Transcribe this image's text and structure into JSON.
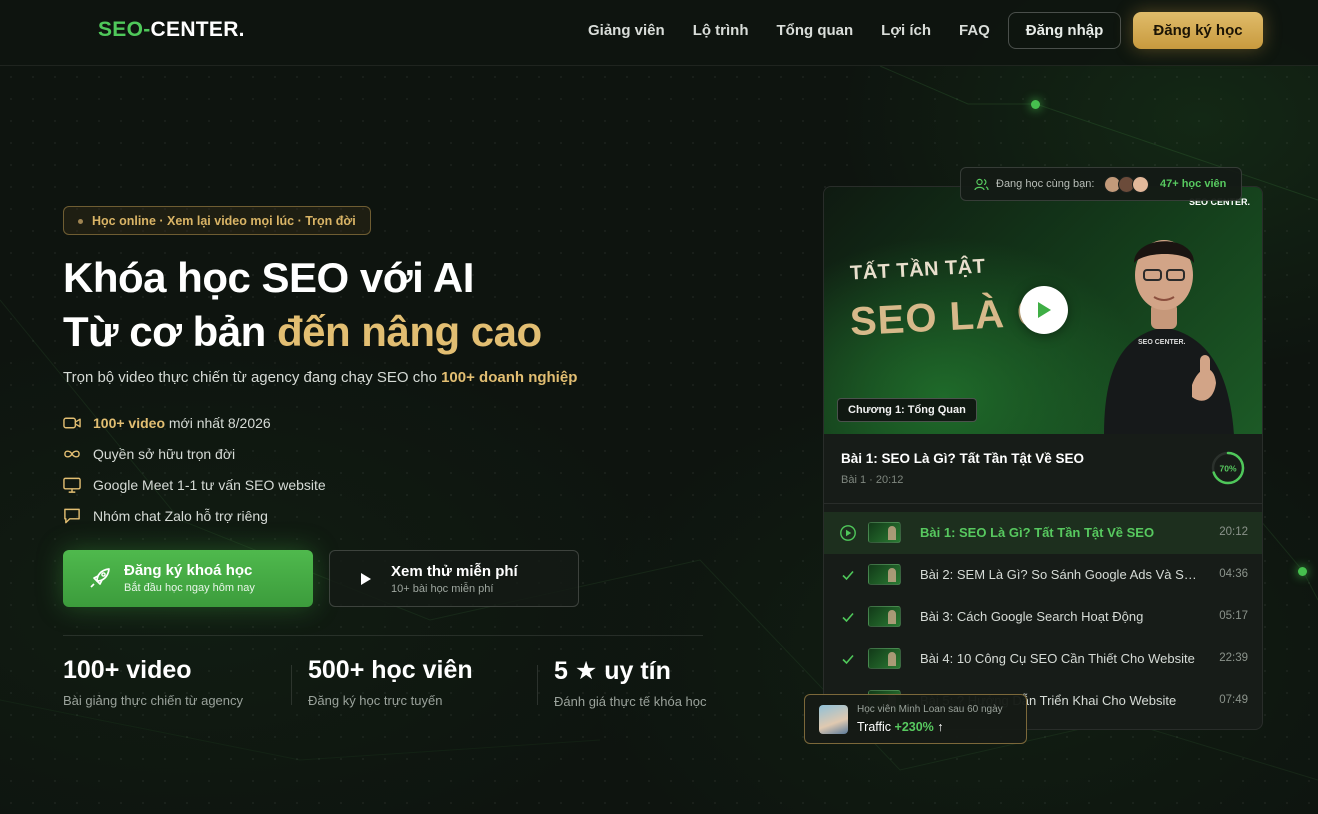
{
  "header": {
    "logo_part1": "SEO",
    "logo_part2": "CENTER.",
    "nav": [
      "Giảng viên",
      "Lộ trình",
      "Tổng quan",
      "Lợi ích",
      "FAQ"
    ],
    "login_label": "Đăng nhập",
    "register_label": "Đăng ký học"
  },
  "hero": {
    "pill": "Học online · Xem lại video mọi lúc · Trọn đời",
    "title_line1": "Khóa học SEO với AI",
    "title_line2_plain": "Từ cơ bản ",
    "title_line2_gold": "đến nâng cao",
    "subtitle_plain": "Trọn bộ video thực chiến từ agency đang chạy SEO cho ",
    "subtitle_gold": "100+ doanh nghiệp",
    "features": [
      {
        "icon": "video-camera-icon",
        "gold": "100+ video",
        "text": " mới nhất 8/2026"
      },
      {
        "icon": "infinity-icon",
        "gold": "",
        "text": "Quyền sở hữu trọn đời"
      },
      {
        "icon": "monitor-icon",
        "gold": "",
        "text": "Google Meet 1-1 tư vấn SEO website"
      },
      {
        "icon": "chat-bubble-icon",
        "gold": "",
        "text": "Nhóm chat Zalo hỗ trợ riêng"
      }
    ],
    "cta_main": {
      "title": "Đăng ký khoá học",
      "subtitle": "Bắt đầu học ngay hôm nay",
      "icon": "rocket-icon"
    },
    "cta_free": {
      "title": "Xem thử miễn phí",
      "subtitle": "10+ bài học miễn phí",
      "icon": "play-icon"
    },
    "stats": [
      {
        "value": "100+ video",
        "label": "Bài giảng thực chiến từ agency"
      },
      {
        "value": "500+ học viên",
        "label": "Đăng ký học trực tuyến"
      },
      {
        "value": "5 ★ uy tín",
        "label": "Đánh giá thực tế khóa học"
      }
    ]
  },
  "player": {
    "learning_now": "Đang học cùng bạn:",
    "learners_count": "47+ học viên",
    "video_logo": "SEO CENTER.",
    "thumb_line1": "TẤT TẦN TẬT",
    "thumb_line2": "SEO LÀ G",
    "shirt_logo": "SEO CENTER.",
    "chapter": "Chương 1: Tổng Quan",
    "current_title": "Bài 1: SEO Là Gì? Tất Tần Tật Về SEO",
    "current_meta": "Bài 1 · 20:12",
    "progress_label": "70%",
    "progress_value": 0.7,
    "lessons": [
      {
        "title": "Bài 1: SEO Là Gì? Tất Tần Tật Về SEO",
        "duration": "20:12",
        "state": "playing"
      },
      {
        "title": "Bài 2: SEM Là Gì? So Sánh Google Ads Và SEO",
        "duration": "04:36",
        "state": "done"
      },
      {
        "title": "Bài 3: Cách Google Search Hoạt Động",
        "duration": "05:17",
        "state": "done"
      },
      {
        "title": "Bài 4: 10 Công Cụ SEO Cần Thiết Cho Website",
        "duration": "22:39",
        "state": "done"
      },
      {
        "title": "Bài 5: ? Hướng Dẫn Triển Khai Cho Website",
        "duration": "07:49",
        "state": "none"
      }
    ]
  },
  "toast": {
    "line1": "Học viên Minh Loan sau 60 ngày",
    "line2_plain": "Traffic ",
    "line2_value": "+230%",
    "arrow": "↑"
  },
  "colors": {
    "green": "#4fc85a",
    "gold": "#e2be72",
    "background": "#0e140f"
  }
}
